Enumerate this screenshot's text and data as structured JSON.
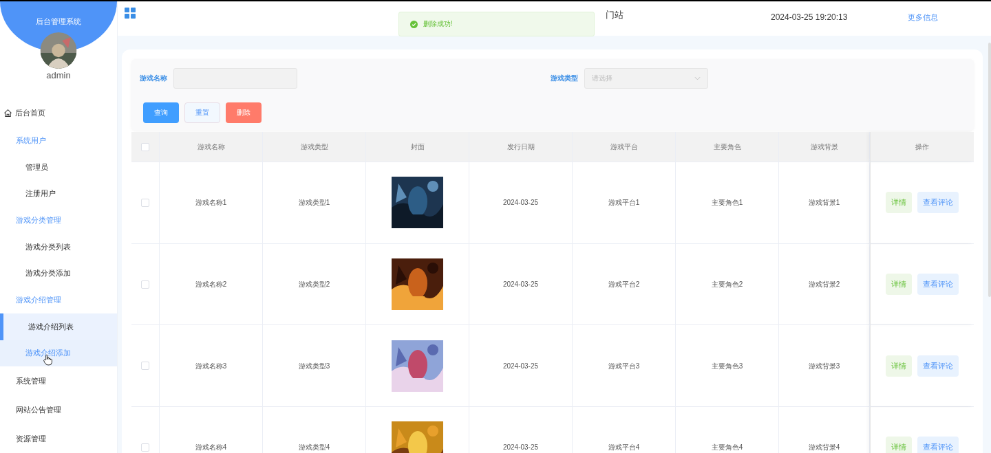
{
  "sidebar": {
    "title": "后台管理系统",
    "user": "admin",
    "items": [
      {
        "label": "后台首页",
        "kind": "home"
      },
      {
        "label": "系统用户",
        "kind": "group",
        "children": [
          {
            "label": "管理员",
            "selected": false,
            "hovered": false
          },
          {
            "label": "注册用户",
            "selected": false,
            "hovered": false
          }
        ]
      },
      {
        "label": "游戏分类管理",
        "kind": "group",
        "children": [
          {
            "label": "游戏分类列表",
            "selected": false,
            "hovered": false
          },
          {
            "label": "游戏分类添加",
            "selected": false,
            "hovered": false
          }
        ]
      },
      {
        "label": "游戏介绍管理",
        "kind": "group",
        "children": [
          {
            "label": "游戏介绍列表",
            "selected": true,
            "hovered": false
          },
          {
            "label": "游戏介绍添加",
            "selected": false,
            "hovered": true
          }
        ]
      },
      {
        "label": "系统管理",
        "kind": "link"
      },
      {
        "label": "网站公告管理",
        "kind": "link"
      },
      {
        "label": "资源管理",
        "kind": "link"
      }
    ]
  },
  "header": {
    "title_fragment": "门站",
    "datetime": "2024-03-25 19:20:13",
    "more_link": "更多信息"
  },
  "toast": {
    "message": "删除成功!"
  },
  "search": {
    "fields": [
      {
        "label": "游戏名称",
        "kind": "text"
      },
      {
        "label": "游戏类型",
        "kind": "select",
        "placeholder": "请选择"
      }
    ],
    "buttons": [
      {
        "label": "查询",
        "kind": "primary"
      },
      {
        "label": "重置",
        "kind": "plain"
      },
      {
        "label": "删除",
        "kind": "danger"
      }
    ]
  },
  "table": {
    "select_all": false,
    "columns": [
      "游戏名称",
      "游戏类型",
      "封面",
      "发行日期",
      "游戏平台",
      "主要角色",
      "游戏背景",
      "操作"
    ],
    "rows": [
      {
        "checked": false,
        "name": "游戏名称1",
        "type": "游戏类型1",
        "cover": {
          "kind": "picture"
        },
        "date": "2024-03-25",
        "platform": "游戏平台1",
        "role": "主要角色1",
        "background": "游戏背景1",
        "actions": [
          "详情",
          "查看评论"
        ]
      },
      {
        "checked": false,
        "name": "游戏名称2",
        "type": "游戏类型2",
        "cover": {
          "kind": "picture"
        },
        "date": "2024-03-25",
        "platform": "游戏平台2",
        "role": "主要角色2",
        "background": "游戏背景2",
        "actions": [
          "详情",
          "查看评论"
        ]
      },
      {
        "checked": false,
        "name": "游戏名称3",
        "type": "游戏类型3",
        "cover": {
          "kind": "picture"
        },
        "date": "2024-03-25",
        "platform": "游戏平台3",
        "role": "主要角色3",
        "background": "游戏背景3",
        "actions": [
          "详情",
          "查看评论"
        ]
      },
      {
        "checked": false,
        "name": "游戏名称4",
        "type": "游戏类型4",
        "cover": {
          "kind": "picture"
        },
        "date": "2024-03-25",
        "platform": "游戏平台4",
        "role": "主要角色4",
        "background": "游戏背景4",
        "actions": [
          "详情",
          "查看评论"
        ]
      }
    ]
  }
}
